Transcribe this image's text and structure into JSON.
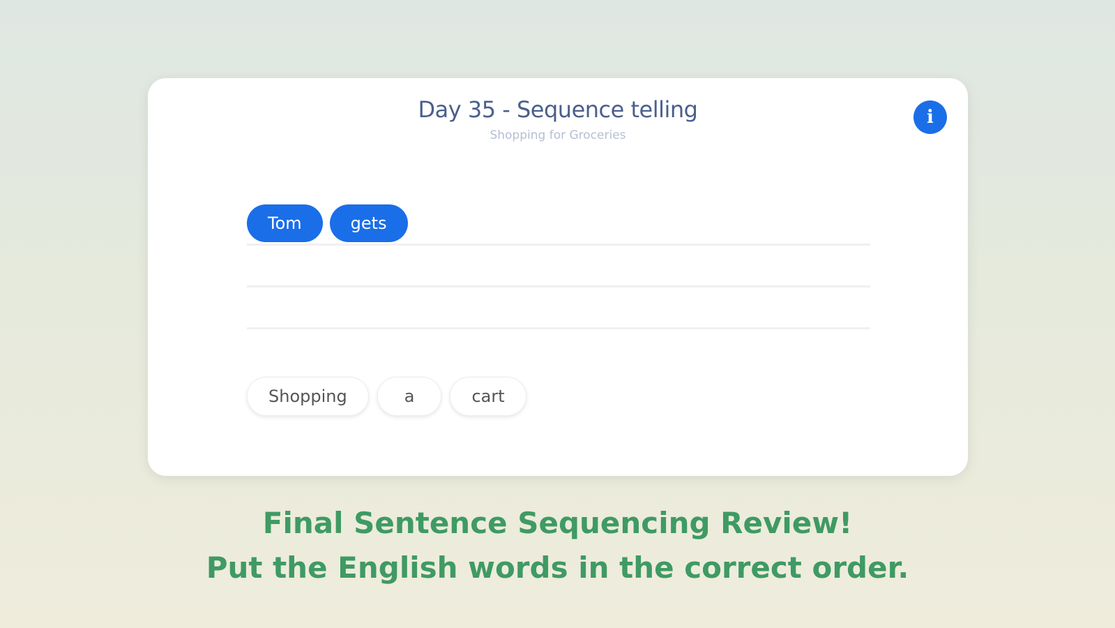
{
  "card": {
    "title": "Day 35 - Sequence telling",
    "subtitle": "Shopping for Groceries",
    "info_icon": "info-icon",
    "info_glyph": "i"
  },
  "answer": {
    "selected_words": [
      "Tom",
      "gets"
    ]
  },
  "word_bank": {
    "words": [
      "Shopping",
      "a",
      "cart"
    ]
  },
  "instructions": {
    "line1": "Final Sentence Sequencing Review!",
    "line2": "Put the English words in the correct order."
  },
  "colors": {
    "accent": "#1a6ee8",
    "title": "#4a5f8c",
    "instruction": "#3f9a63"
  }
}
